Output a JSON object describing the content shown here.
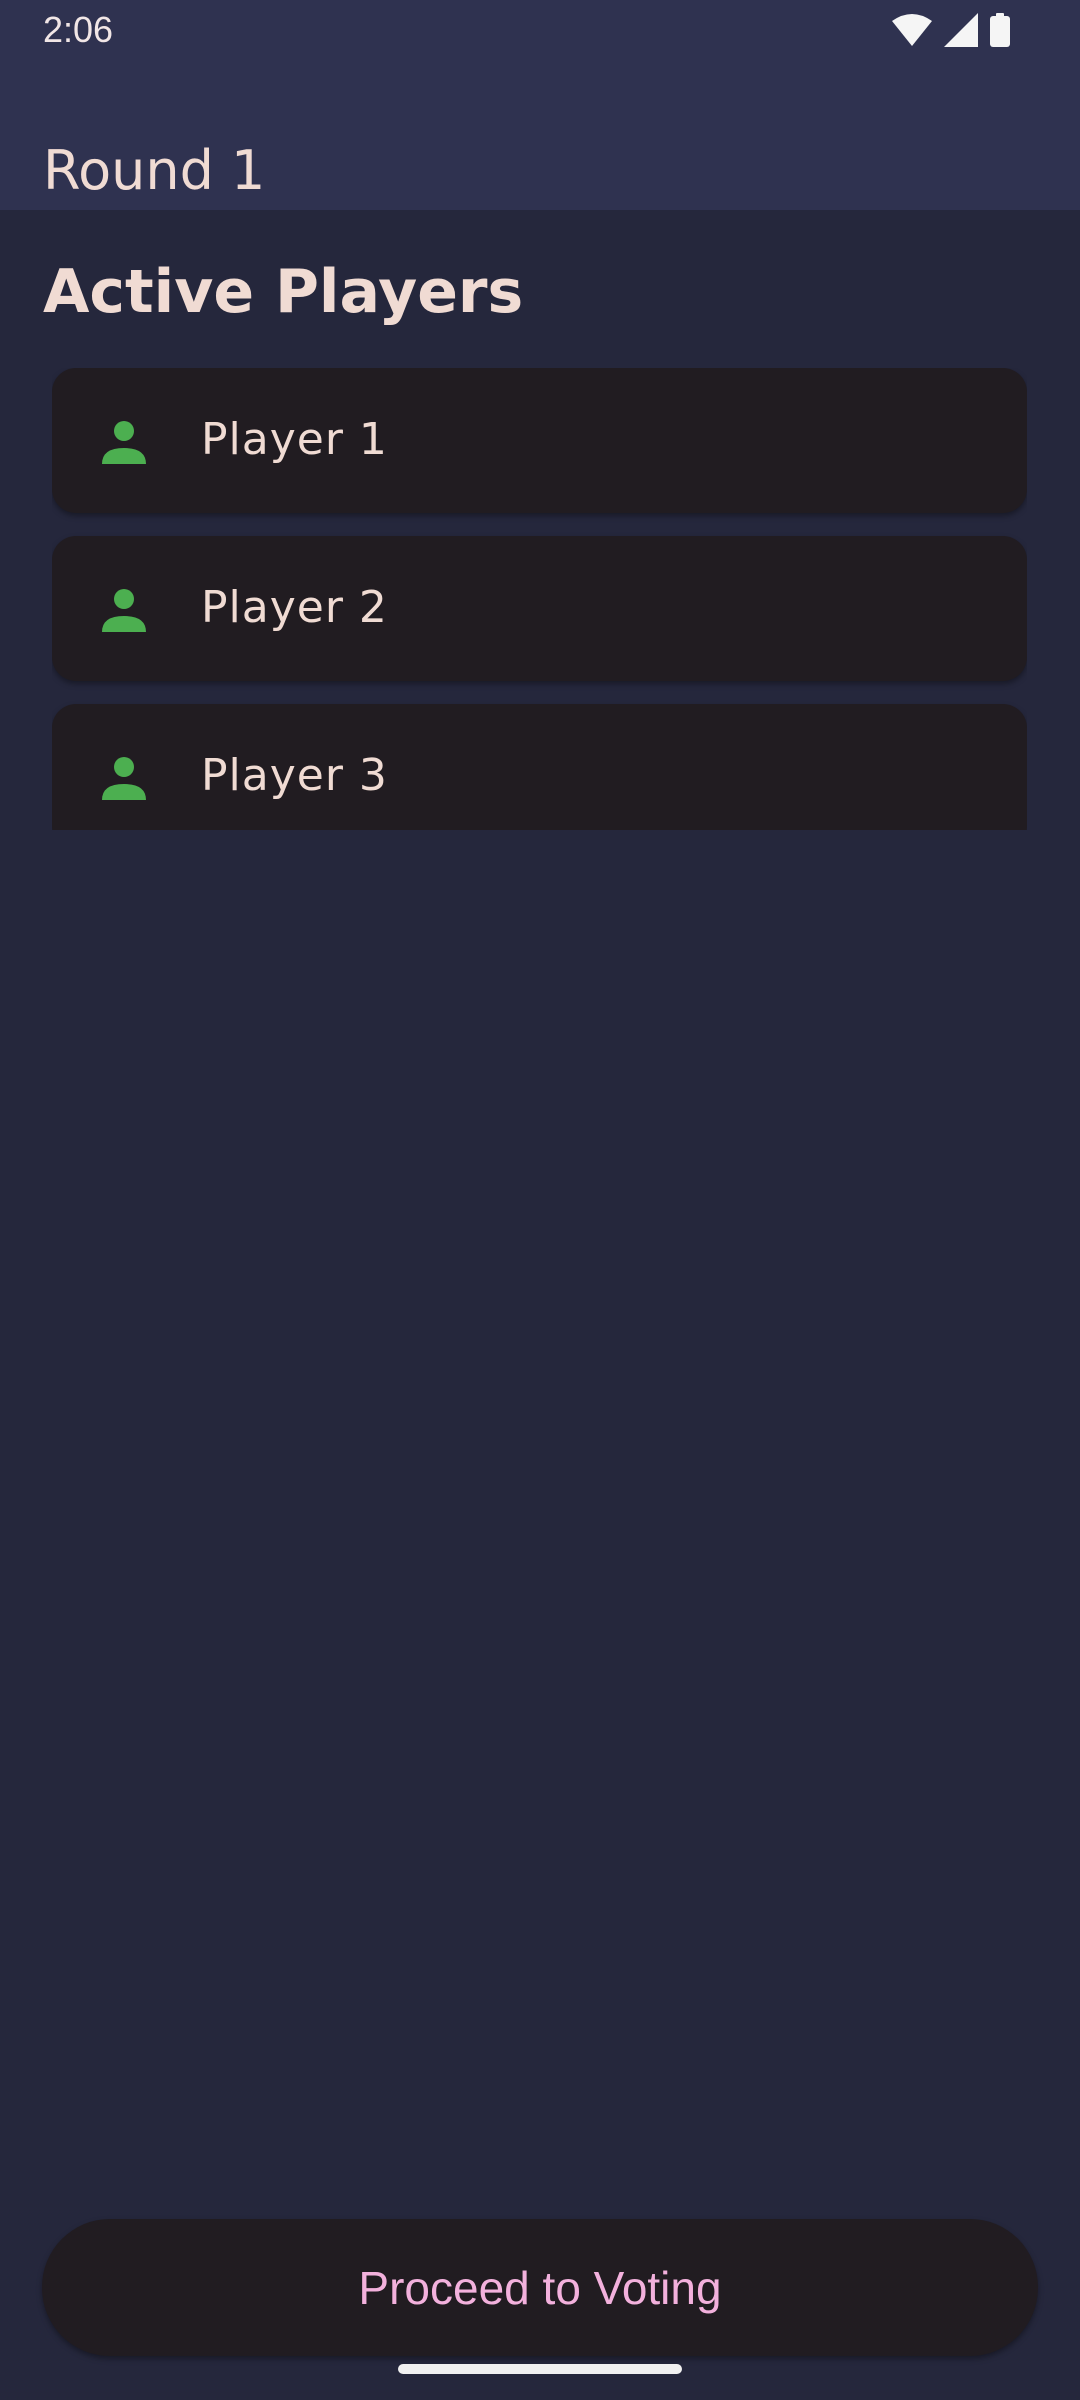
{
  "status_bar": {
    "time": "2:06",
    "icons": [
      "wifi-icon",
      "cellular-signal-icon",
      "battery-icon"
    ]
  },
  "app_bar": {
    "title": "Round 1"
  },
  "section": {
    "title": "Active Players"
  },
  "players": [
    {
      "name": "Player 1",
      "icon": "person-icon"
    },
    {
      "name": "Player 2",
      "icon": "person-icon"
    },
    {
      "name": "Player 3",
      "icon": "person-icon"
    }
  ],
  "actions": {
    "proceed_label": "Proceed to Voting"
  },
  "colors": {
    "background": "#25273c",
    "app_bar": "#2f3250",
    "card": "#211c21",
    "text_primary": "#f0dbd3",
    "accent_icon": "#4caf50",
    "button_text": "#f3b1dd"
  }
}
